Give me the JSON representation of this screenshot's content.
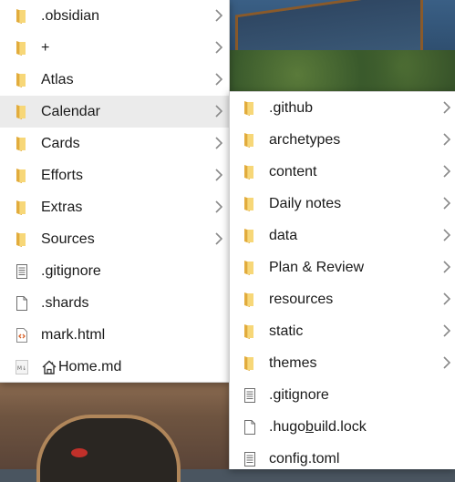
{
  "main_menu": {
    "items": [
      {
        "label": ".obsidian",
        "type": "folder",
        "submenu": true
      },
      {
        "label": "+",
        "type": "folder",
        "submenu": true
      },
      {
        "label": "Atlas",
        "type": "folder",
        "submenu": true
      },
      {
        "label": "Calendar",
        "type": "folder",
        "submenu": true,
        "highlighted": true
      },
      {
        "label": "Cards",
        "type": "folder",
        "submenu": true
      },
      {
        "label": "Efforts",
        "type": "folder",
        "submenu": true
      },
      {
        "label": "Extras",
        "type": "folder",
        "submenu": true
      },
      {
        "label": "Sources",
        "type": "folder",
        "submenu": true
      },
      {
        "label": ".gitignore",
        "type": "text-file"
      },
      {
        "label": ".shards",
        "type": "blank-file"
      },
      {
        "label": "mark.html",
        "type": "html-file"
      },
      {
        "label": "Home.md",
        "type": "markdown-file",
        "prefix_icon": "home-icon"
      }
    ]
  },
  "sub_menu": {
    "items": [
      {
        "label": ".github",
        "type": "folder",
        "submenu": true
      },
      {
        "label": "archetypes",
        "type": "folder",
        "submenu": true
      },
      {
        "label": "content",
        "type": "folder",
        "submenu": true
      },
      {
        "label": "Daily notes",
        "type": "folder",
        "submenu": true
      },
      {
        "label": "data",
        "type": "folder",
        "submenu": true
      },
      {
        "label": "Plan & Review",
        "type": "folder",
        "submenu": true
      },
      {
        "label": "resources",
        "type": "folder",
        "submenu": true
      },
      {
        "label": "static",
        "type": "folder",
        "submenu": true
      },
      {
        "label": "themes",
        "type": "folder",
        "submenu": true
      },
      {
        "label": ".gitignore",
        "type": "text-file"
      },
      {
        "label_before": ".hugo",
        "label_underlined": "b",
        "label_after": "uild.lock",
        "type": "blank-file"
      },
      {
        "label": "config.toml",
        "type": "text-file"
      }
    ]
  },
  "colors": {
    "folder_back": "#e8b64a",
    "folder_front": "#f6d47a",
    "highlight": "#ebebeb",
    "chevron": "#8a8a8a",
    "html_icon": "#d9632a"
  }
}
